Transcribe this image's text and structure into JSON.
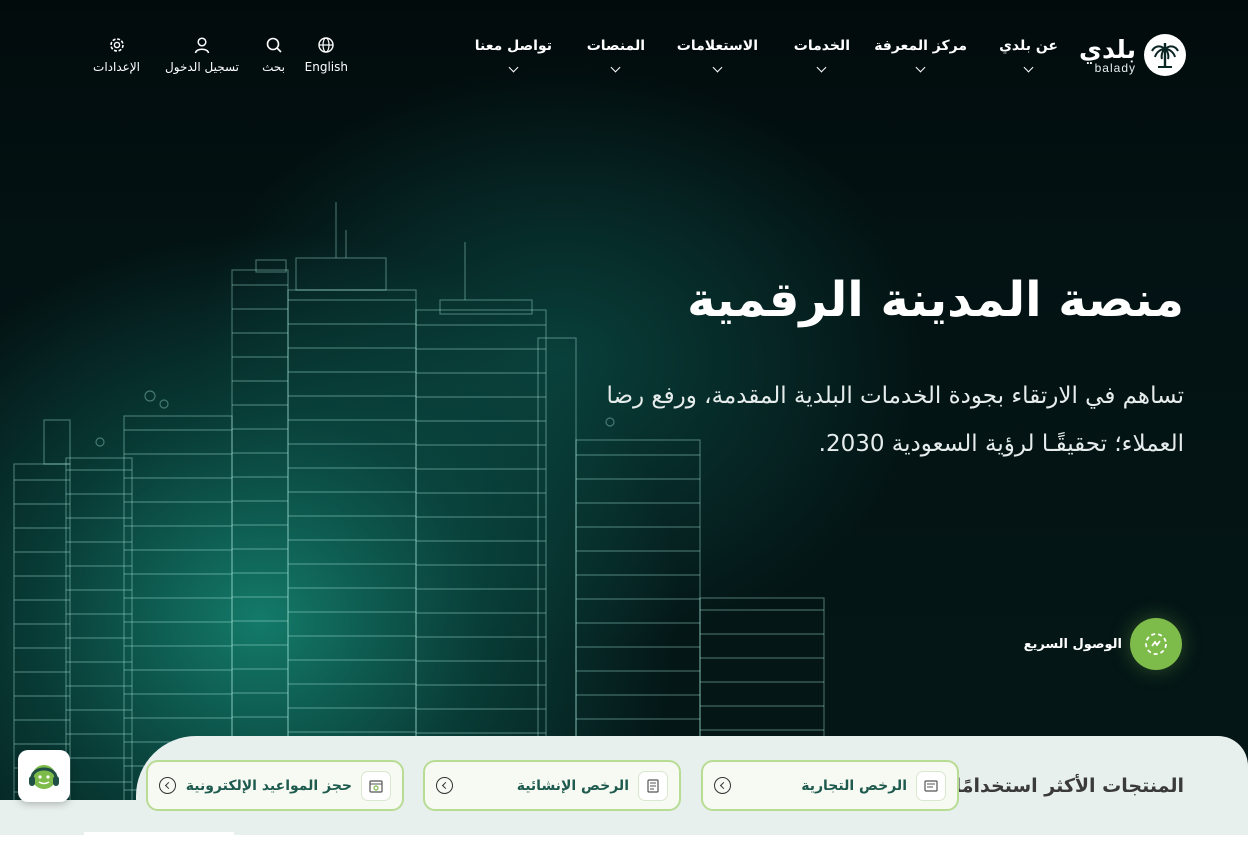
{
  "logo": {
    "arabic": "بلدي",
    "latin": "balady",
    "icon": "palm-tree-logo-icon"
  },
  "nav": {
    "items": [
      {
        "label": "عن بلدي",
        "icon": "chevron-down-icon"
      },
      {
        "label": "مركز المعرفة",
        "icon": "chevron-down-icon"
      },
      {
        "label": "الخدمات",
        "icon": "chevron-down-icon"
      },
      {
        "label": "الاستعلامات",
        "icon": "chevron-down-icon"
      },
      {
        "label": "المنصات",
        "icon": "chevron-down-icon"
      },
      {
        "label": "تواصل معنا",
        "icon": "chevron-down-icon"
      }
    ]
  },
  "utility": {
    "language": {
      "label": "English",
      "icon": "globe-icon"
    },
    "search": {
      "label": "بحث",
      "icon": "search-icon"
    },
    "login": {
      "label": "تسجيل الدخول",
      "icon": "user-icon"
    },
    "settings": {
      "label": "الإعدادات",
      "icon": "gear-icon"
    }
  },
  "hero": {
    "title": "منصة المدينة الرقمية",
    "subtitle_line1": "تساهم في الارتقاء بجودة الخدمات البلدية المقدمة، ورفع رضا",
    "subtitle_line2": "العملاء؛ تحقيقًـا لرؤية السعودية 2030."
  },
  "quick_access": {
    "label": "الوصول السريع",
    "icon": "quick-access-icon"
  },
  "products": {
    "title": "المنتجات الأكثر استخدامًا",
    "items": [
      {
        "label": "الرخص التجارية",
        "icon": "commercial-license-icon"
      },
      {
        "label": "الرخص الإنشائية",
        "icon": "construction-license-icon"
      },
      {
        "label": "حجز المواعيد الإلكترونية",
        "icon": "appointment-booking-icon"
      }
    ]
  },
  "assistant": {
    "icon": "support-headset-icon"
  },
  "colors": {
    "accent_green": "#7dbb4a",
    "teal_glow": "#168c78",
    "card_border": "#b8dc93",
    "strip_bg": "#e8f0ee"
  }
}
